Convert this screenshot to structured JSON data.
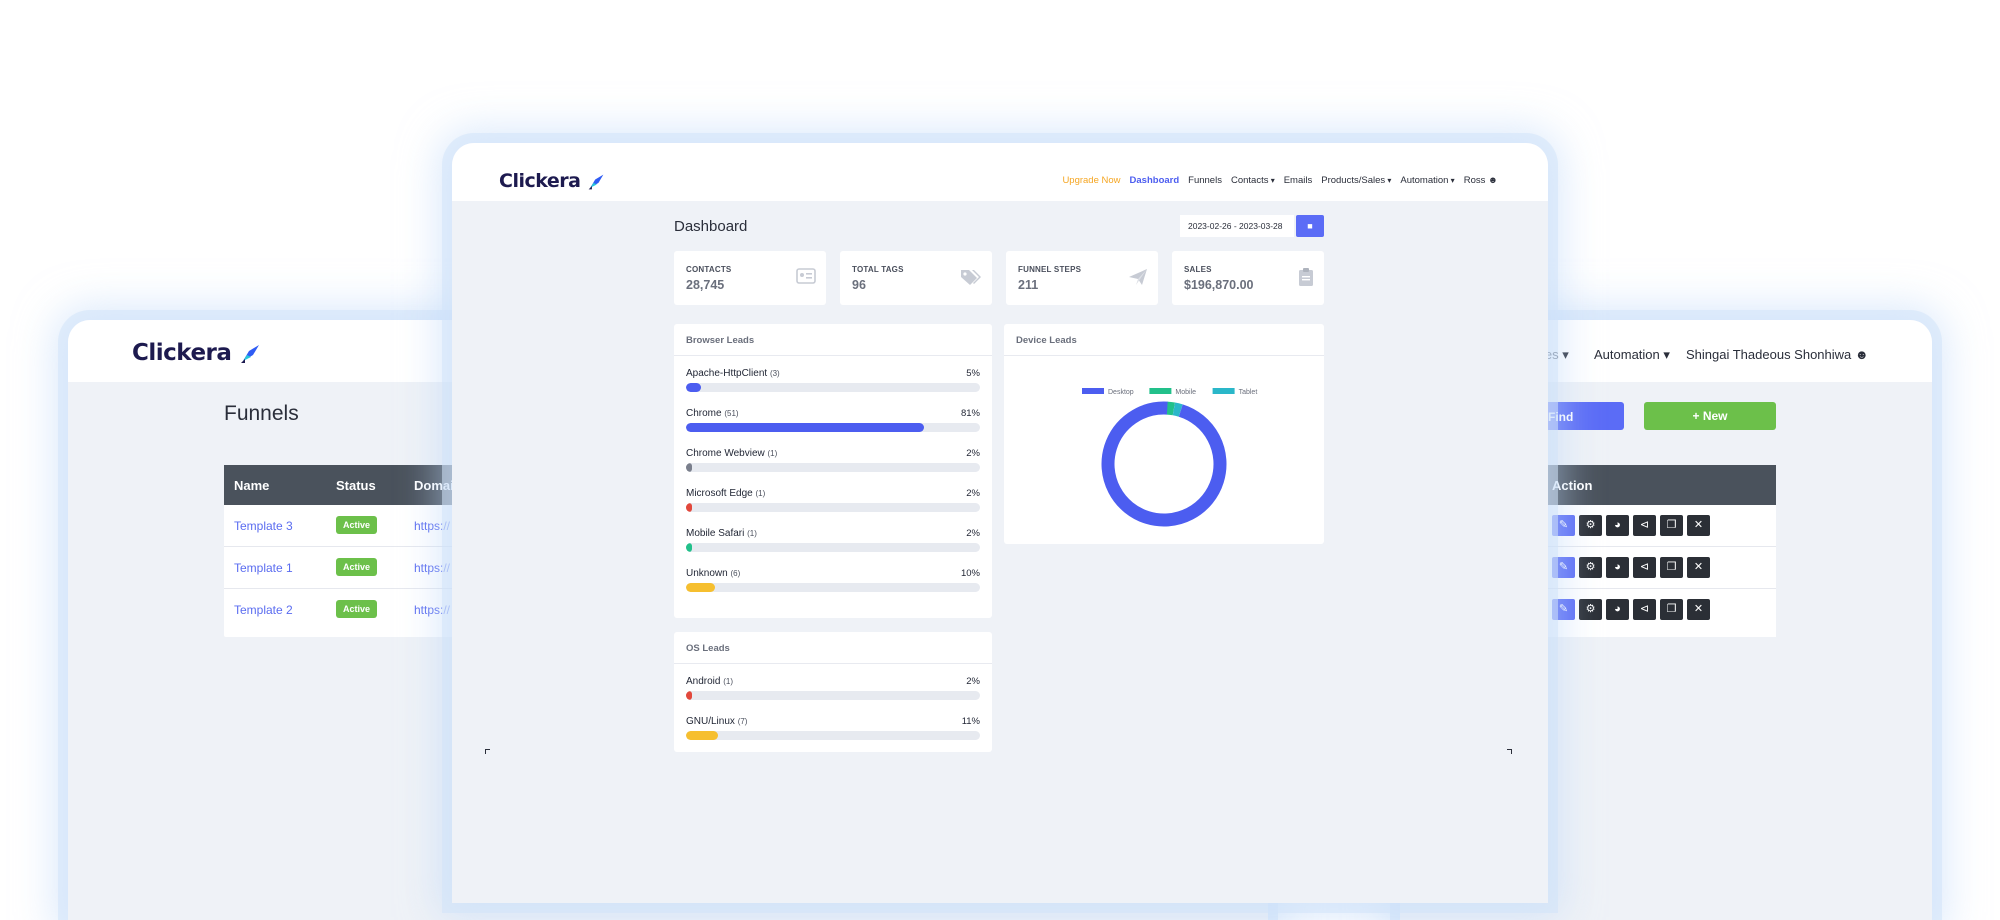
{
  "brand": "Clickera",
  "funnels_window": {
    "title": "Funnels",
    "columns": [
      "Name",
      "Status",
      "Domai"
    ],
    "rows": [
      {
        "name": "Template 3",
        "status": "Active",
        "url": "https://"
      },
      {
        "name": "Template 1",
        "status": "Active",
        "url": "https://"
      },
      {
        "name": "Template 2",
        "status": "Active",
        "url": "https://"
      }
    ]
  },
  "actions_window": {
    "nav_partial": "les",
    "nav_automation": "Automation",
    "user": "Shingai Thadeous Shonhiwa",
    "find_label": "Find",
    "new_label": "+ New",
    "action_header": "Action",
    "row_actions": [
      "edit",
      "settings",
      "stats",
      "share",
      "copy",
      "delete"
    ]
  },
  "dashboard": {
    "nav": {
      "upgrade": "Upgrade Now",
      "dashboard": "Dashboard",
      "funnels": "Funnels",
      "contacts": "Contacts",
      "emails": "Emails",
      "products": "Products/Sales",
      "automation": "Automation",
      "user": "Ross"
    },
    "title": "Dashboard",
    "date_range": "2023-02-26 - 2023-03-28",
    "stats": [
      {
        "label": "CONTACTS",
        "value": "28,745",
        "icon": "id-card-icon"
      },
      {
        "label": "TOTAL TAGS",
        "value": "96",
        "icon": "tags-icon"
      },
      {
        "label": "FUNNEL STEPS",
        "value": "211",
        "icon": "paper-plane-icon"
      },
      {
        "label": "SALES",
        "value": "$196,870.00",
        "icon": "clipboard-icon"
      }
    ],
    "browser_leads": {
      "title": "Browser Leads",
      "items": [
        {
          "name": "Apache-HttpClient",
          "count": "(3)",
          "pct": "5%",
          "fraction": 0.05,
          "color": "#4c5df0"
        },
        {
          "name": "Chrome",
          "count": "(51)",
          "pct": "81%",
          "fraction": 0.81,
          "color": "#4c5df0"
        },
        {
          "name": "Chrome Webview",
          "count": "(1)",
          "pct": "2%",
          "fraction": 0.02,
          "color": "#7a7f8c"
        },
        {
          "name": "Microsoft Edge",
          "count": "(1)",
          "pct": "2%",
          "fraction": 0.02,
          "color": "#e2483c"
        },
        {
          "name": "Mobile Safari",
          "count": "(1)",
          "pct": "2%",
          "fraction": 0.02,
          "color": "#22c08a"
        },
        {
          "name": "Unknown",
          "count": "(6)",
          "pct": "10%",
          "fraction": 0.1,
          "color": "#f6bf2f"
        }
      ]
    },
    "device_leads": {
      "title": "Device Leads"
    },
    "os_leads": {
      "title": "OS Leads",
      "items": [
        {
          "name": "Android",
          "count": "(1)",
          "pct": "2%",
          "fraction": 0.02,
          "color": "#e2483c"
        },
        {
          "name": "GNU/Linux",
          "count": "(7)",
          "pct": "11%",
          "fraction": 0.11,
          "color": "#f6bf2f"
        }
      ]
    }
  },
  "chart_data": {
    "type": "pie",
    "title": "",
    "categories": [
      "Desktop",
      "Mobile",
      "Tablet"
    ],
    "values": [
      96,
      2,
      2
    ],
    "colors": [
      "#4c5df0",
      "#22c08a",
      "#2ab7c9"
    ],
    "legend": "top"
  }
}
